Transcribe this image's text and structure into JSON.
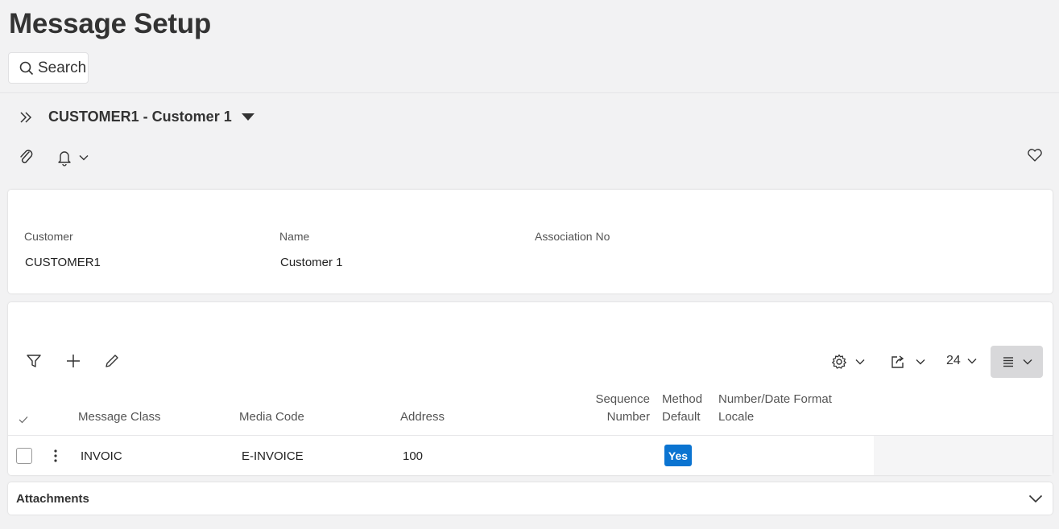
{
  "page": {
    "title": "Message Setup"
  },
  "search": {
    "label": "Search"
  },
  "record": {
    "title": "CUSTOMER1 - Customer 1"
  },
  "header_card": {
    "fields": [
      {
        "label": "Customer",
        "value": "CUSTOMER1"
      },
      {
        "label": "Name",
        "value": "Customer 1"
      },
      {
        "label": "Association No",
        "value": ""
      }
    ]
  },
  "grid": {
    "page_size": "24",
    "columns": {
      "message_class": "Message Class",
      "media_code": "Media Code",
      "address": "Address",
      "sequence_number_1": "Sequence",
      "sequence_number_2": "Number",
      "method_default_1": "Method",
      "method_default_2": "Default",
      "locale_1": "Number/Date Format",
      "locale_2": "Locale"
    },
    "rows": [
      {
        "message_class": "INVOIC",
        "media_code": "E-INVOICE",
        "address": "100",
        "sequence_number": "",
        "method_default": "Yes",
        "locale": ""
      }
    ]
  },
  "attachments": {
    "title": "Attachments"
  },
  "colors": {
    "accent": "#0b74d1",
    "background": "#f2f2f3"
  }
}
